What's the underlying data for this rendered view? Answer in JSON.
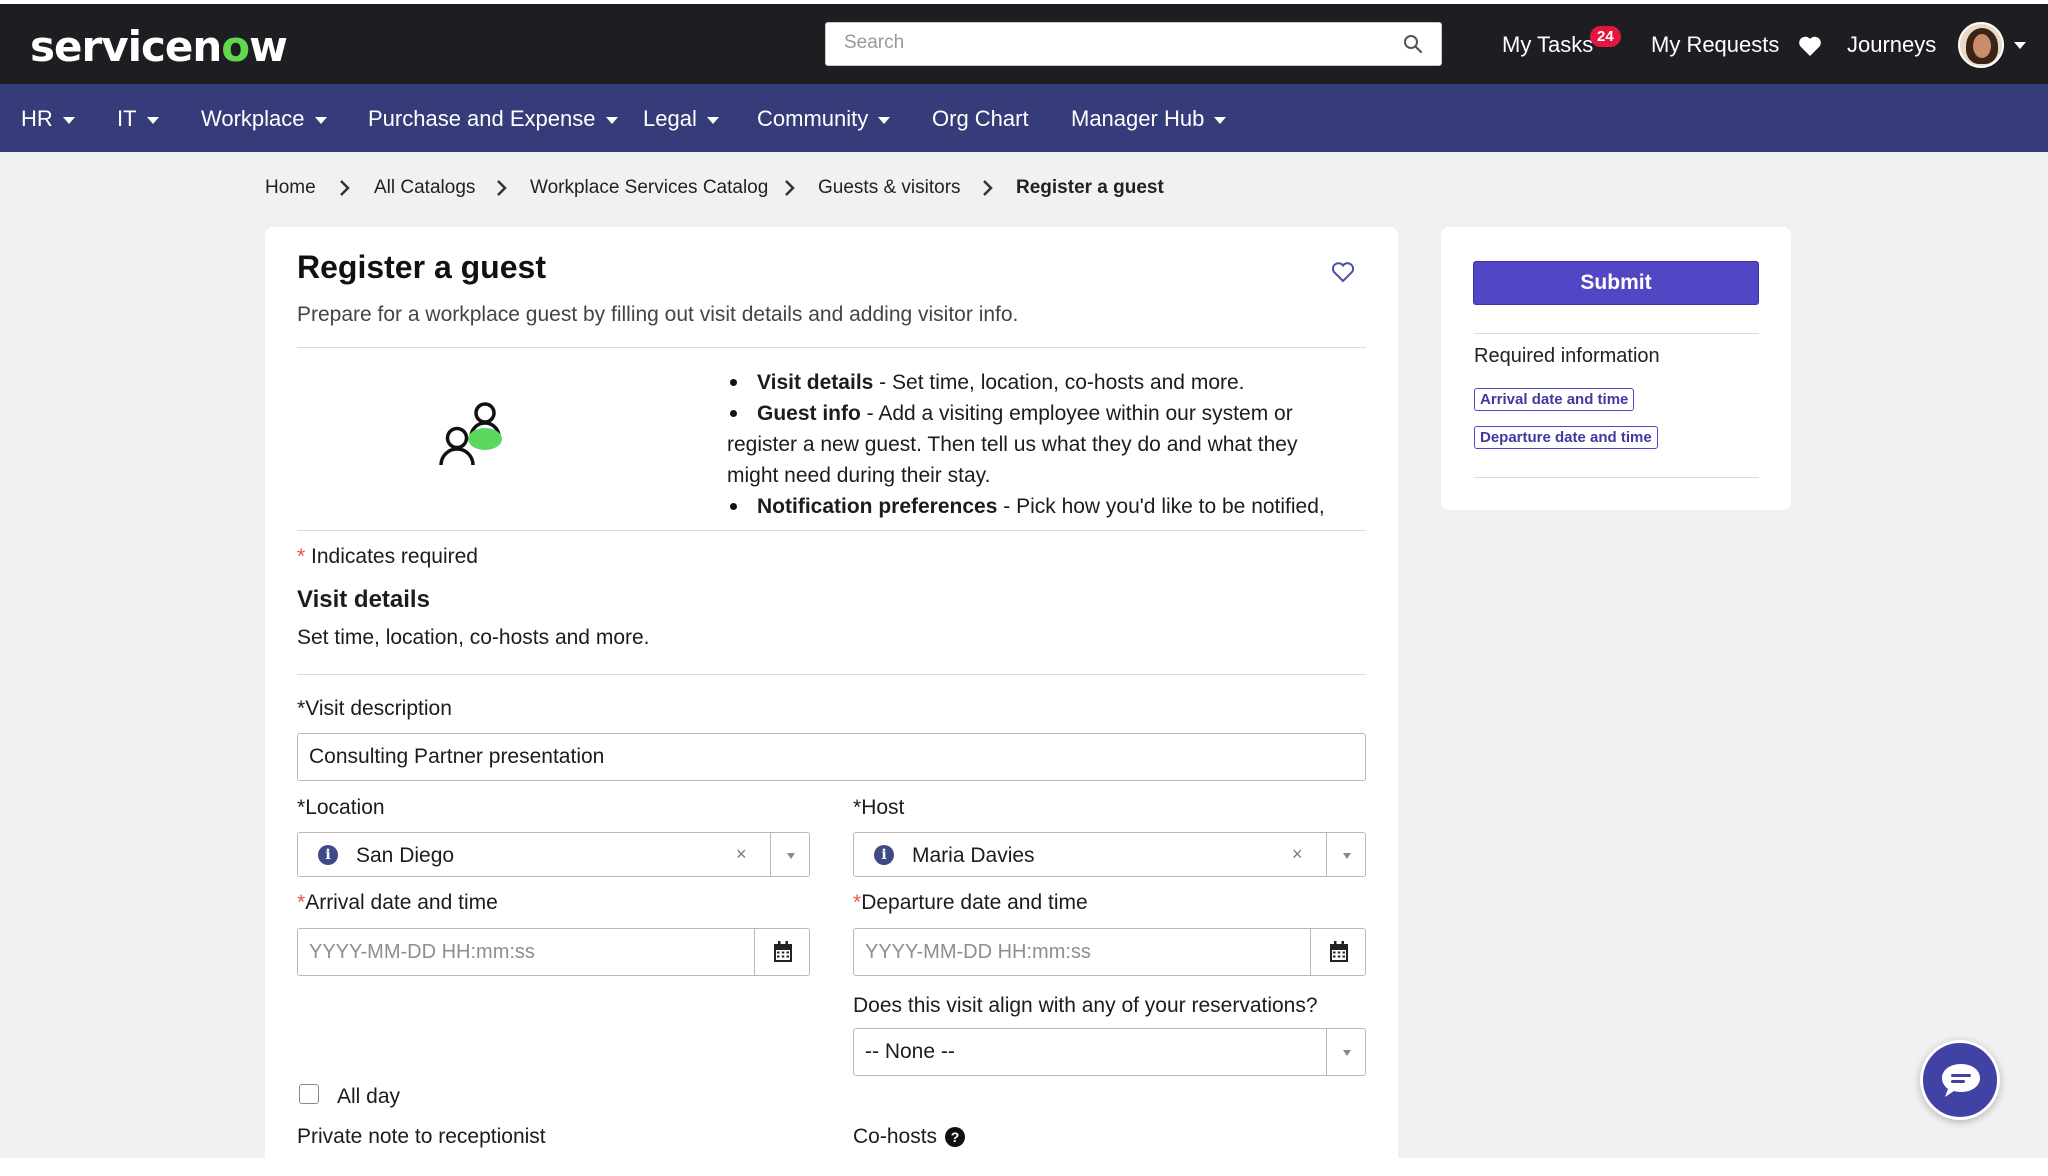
{
  "header": {
    "logo_pre": "servicen",
    "logo_o": "o",
    "logo_post": "w",
    "search_placeholder": "Search",
    "my_tasks": "My Tasks",
    "tasks_badge": "24",
    "my_requests": "My Requests",
    "journeys": "Journeys"
  },
  "nav": {
    "hr": "HR",
    "it": "IT",
    "workplace": "Workplace",
    "purchase": "Purchase and Expense",
    "legal": "Legal",
    "community": "Community",
    "org_chart": "Org Chart",
    "manager_hub": "Manager Hub"
  },
  "breadcrumb": {
    "home": "Home",
    "all_catalogs": "All Catalogs",
    "workplace_catalog": "Workplace Services Catalog",
    "guests": "Guests & visitors",
    "current": "Register a guest"
  },
  "form": {
    "title": "Register a guest",
    "subtitle": "Prepare for a workplace guest by filling out visit details and adding visitor info.",
    "bullet1_bold": "Visit details",
    "bullet1_text": " - Set time, location, co-hosts and more.",
    "bullet2_bold": "Guest info",
    "bullet2_text": " - Add a visiting employee within our system or",
    "bullet2_cont1": "register a new guest. Then tell us what they do and what they",
    "bullet2_cont2": "might need during their stay.",
    "bullet3_bold": "Notification preferences",
    "bullet3_text": " - Pick how you'd like to be notified,",
    "indicates_required": "Indicates required",
    "section_title": "Visit details",
    "section_desc": "Set time, location, co-hosts and more.",
    "visit_description_label": "Visit description",
    "visit_description_value": "Consulting Partner presentation",
    "location_label": "Location",
    "location_value": "San Diego",
    "host_label": "Host",
    "host_value": "Maria Davies",
    "arrival_label": "Arrival date and time",
    "arrival_placeholder": "YYYY-MM-DD HH:mm:ss",
    "departure_label": "Departure date and time",
    "departure_placeholder": "YYYY-MM-DD HH:mm:ss",
    "reservation_question": "Does this visit align with any of your reservations?",
    "reservation_value": "-- None --",
    "all_day_label": "All day",
    "private_note_label": "Private note to receptionist",
    "cohosts_label": "Co-hosts",
    "required_star": "*",
    "clear_glyph": "×",
    "help_glyph": "?"
  },
  "sidebar": {
    "submit": "Submit",
    "required_title": "Required information",
    "chips": [
      "Arrival date and time",
      "Departure date and time"
    ]
  },
  "colors": {
    "topbar": "#1e1e22",
    "navbar": "#363b7a",
    "accent": "#5147c5",
    "brand_green": "#62d84e",
    "required": "#e8583d",
    "badge": "#e3173e"
  },
  "icons": [
    "search-icon",
    "heart-icon",
    "avatar",
    "chevron-right-icon",
    "favorite-heart-icon",
    "guests-illustration-icon",
    "info-icon",
    "clear-icon",
    "chevron-down-icon",
    "calendar-icon",
    "help-icon",
    "chat-icon"
  ]
}
